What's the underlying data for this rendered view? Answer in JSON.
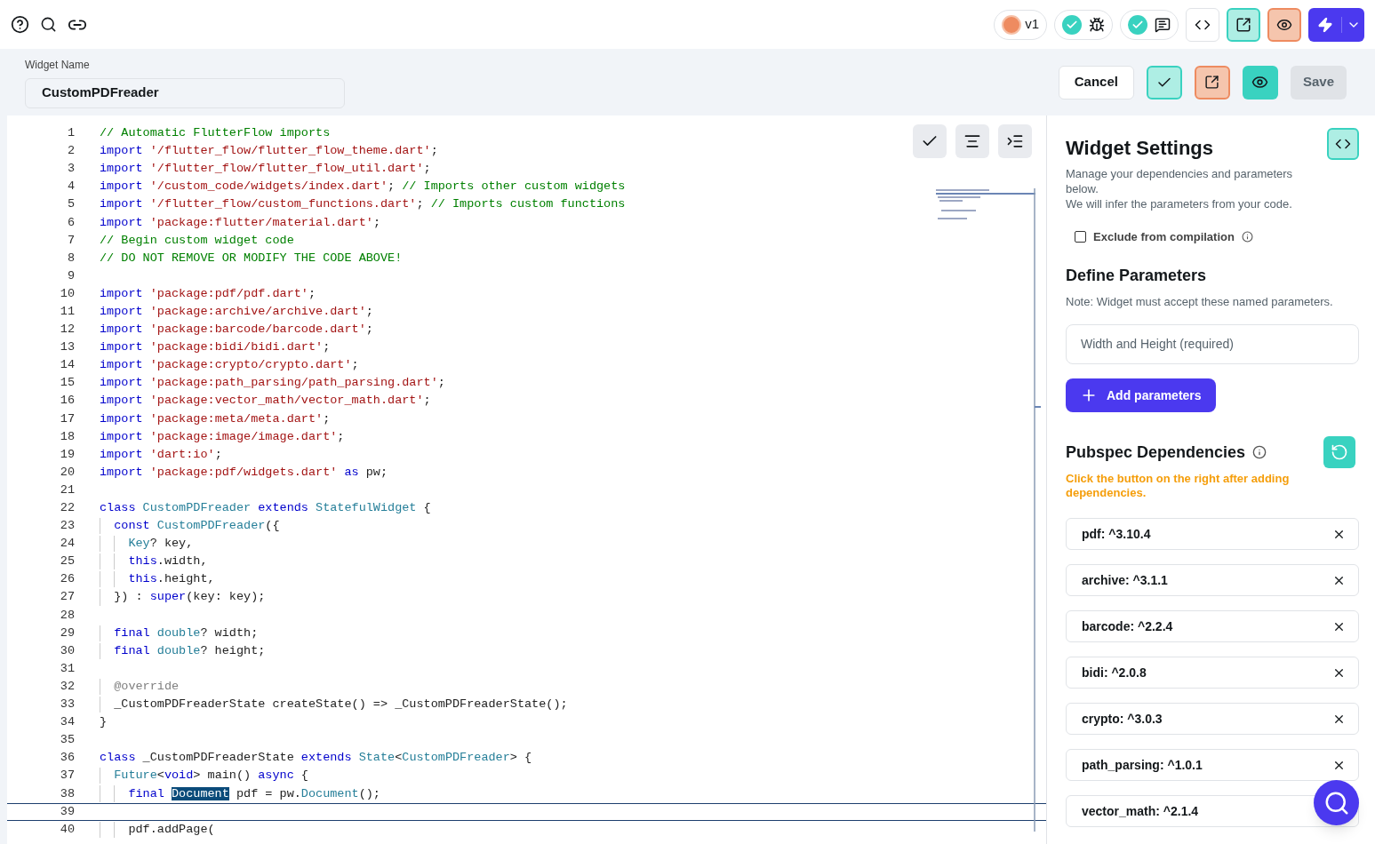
{
  "topbar": {
    "version": "v1"
  },
  "header": {
    "label": "Widget Name",
    "value": "CustomPDFreader",
    "cancel": "Cancel",
    "save": "Save"
  },
  "code": [
    {
      "n": "1",
      "current": false,
      "tokens": [
        {
          "kind": "comment",
          "text": "// Automatic FlutterFlow imports"
        }
      ]
    },
    {
      "n": "2",
      "current": false,
      "tokens": [
        {
          "kind": "keyword",
          "text": "import "
        },
        {
          "kind": "string",
          "text": "'/flutter_flow/flutter_flow_theme.dart'"
        },
        {
          "kind": "plain",
          "text": ";"
        }
      ]
    },
    {
      "n": "3",
      "current": false,
      "tokens": [
        {
          "kind": "keyword",
          "text": "import "
        },
        {
          "kind": "string",
          "text": "'/flutter_flow/flutter_flow_util.dart'"
        },
        {
          "kind": "plain",
          "text": ";"
        }
      ]
    },
    {
      "n": "4",
      "current": false,
      "tokens": [
        {
          "kind": "keyword",
          "text": "import "
        },
        {
          "kind": "string",
          "text": "'/custom_code/widgets/index.dart'"
        },
        {
          "kind": "plain",
          "text": "; "
        },
        {
          "kind": "comment",
          "text": "// Imports other custom widgets"
        }
      ]
    },
    {
      "n": "5",
      "current": false,
      "tokens": [
        {
          "kind": "keyword",
          "text": "import "
        },
        {
          "kind": "string",
          "text": "'/flutter_flow/custom_functions.dart'"
        },
        {
          "kind": "plain",
          "text": "; "
        },
        {
          "kind": "comment",
          "text": "// Imports custom functions"
        }
      ]
    },
    {
      "n": "6",
      "current": false,
      "tokens": [
        {
          "kind": "keyword",
          "text": "import "
        },
        {
          "kind": "string",
          "text": "'package:flutter/material.dart'"
        },
        {
          "kind": "plain",
          "text": ";"
        }
      ]
    },
    {
      "n": "7",
      "current": false,
      "tokens": [
        {
          "kind": "comment",
          "text": "// Begin custom widget code"
        }
      ]
    },
    {
      "n": "8",
      "current": false,
      "tokens": [
        {
          "kind": "comment",
          "text": "// DO NOT REMOVE OR MODIFY THE CODE ABOVE!"
        }
      ]
    },
    {
      "n": "9",
      "current": false
    },
    {
      "n": "10",
      "current": false,
      "tokens": [
        {
          "kind": "keyword",
          "text": "import "
        },
        {
          "kind": "string",
          "text": "'package:pdf/pdf.dart'"
        },
        {
          "kind": "plain",
          "text": ";"
        }
      ]
    },
    {
      "n": "11",
      "current": false,
      "tokens": [
        {
          "kind": "keyword",
          "text": "import "
        },
        {
          "kind": "string",
          "text": "'package:archive/archive.dart'"
        },
        {
          "kind": "plain",
          "text": ";"
        }
      ]
    },
    {
      "n": "12",
      "current": false,
      "tokens": [
        {
          "kind": "keyword",
          "text": "import "
        },
        {
          "kind": "string",
          "text": "'package:barcode/barcode.dart'"
        },
        {
          "kind": "plain",
          "text": ";"
        }
      ]
    },
    {
      "n": "13",
      "current": false,
      "tokens": [
        {
          "kind": "keyword",
          "text": "import "
        },
        {
          "kind": "string",
          "text": "'package:bidi/bidi.dart'"
        },
        {
          "kind": "plain",
          "text": ";"
        }
      ]
    },
    {
      "n": "14",
      "current": false,
      "tokens": [
        {
          "kind": "keyword",
          "text": "import "
        },
        {
          "kind": "string",
          "text": "'package:crypto/crypto.dart'"
        },
        {
          "kind": "plain",
          "text": ";"
        }
      ]
    },
    {
      "n": "15",
      "current": false,
      "tokens": [
        {
          "kind": "keyword",
          "text": "import "
        },
        {
          "kind": "string",
          "text": "'package:path_parsing/path_parsing.dart'"
        },
        {
          "kind": "plain",
          "text": ";"
        }
      ]
    },
    {
      "n": "16",
      "current": false,
      "tokens": [
        {
          "kind": "keyword",
          "text": "import "
        },
        {
          "kind": "string",
          "text": "'package:vector_math/vector_math.dart'"
        },
        {
          "kind": "plain",
          "text": ";"
        }
      ]
    },
    {
      "n": "17",
      "current": false,
      "tokens": [
        {
          "kind": "keyword",
          "text": "import "
        },
        {
          "kind": "string",
          "text": "'package:meta/meta.dart'"
        },
        {
          "kind": "plain",
          "text": ";"
        }
      ]
    },
    {
      "n": "18",
      "current": false,
      "tokens": [
        {
          "kind": "keyword",
          "text": "import "
        },
        {
          "kind": "string",
          "text": "'package:image/image.dart'"
        },
        {
          "kind": "plain",
          "text": ";"
        }
      ]
    },
    {
      "n": "19",
      "current": false,
      "tokens": [
        {
          "kind": "keyword",
          "text": "import "
        },
        {
          "kind": "string",
          "text": "'dart:io'"
        },
        {
          "kind": "plain",
          "text": ";"
        }
      ]
    },
    {
      "n": "20",
      "current": false,
      "tokens": [
        {
          "kind": "keyword",
          "text": "import "
        },
        {
          "kind": "string",
          "text": "'package:pdf/widgets.dart'"
        },
        {
          "kind": "keyword",
          "text": " as "
        },
        {
          "kind": "plain",
          "text": "pw;"
        }
      ]
    },
    {
      "n": "21",
      "current": false
    },
    {
      "n": "22",
      "current": false,
      "tokens": [
        {
          "kind": "keyword",
          "text": "class "
        },
        {
          "kind": "type",
          "text": "CustomPDFreader "
        },
        {
          "kind": "keyword",
          "text": "extends "
        },
        {
          "kind": "type",
          "text": "StatefulWidget "
        },
        {
          "kind": "plain",
          "text": "{"
        }
      ]
    },
    {
      "n": "23",
      "current": false,
      "tokens": [
        {
          "kind": "keyword",
          "text": "  const "
        },
        {
          "kind": "type",
          "text": "CustomPDFreader"
        },
        {
          "kind": "plain",
          "text": "({"
        }
      ]
    },
    {
      "n": "24",
      "current": false,
      "tokens": [
        {
          "kind": "type",
          "text": "    Key"
        },
        {
          "kind": "plain",
          "text": "? key,"
        }
      ]
    },
    {
      "n": "25",
      "current": false,
      "tokens": [
        {
          "kind": "keyword",
          "text": "    this"
        },
        {
          "kind": "plain",
          "text": ".width,"
        }
      ]
    },
    {
      "n": "26",
      "current": false,
      "tokens": [
        {
          "kind": "keyword",
          "text": "    this"
        },
        {
          "kind": "plain",
          "text": ".height,"
        }
      ]
    },
    {
      "n": "27",
      "current": false,
      "tokens": [
        {
          "kind": "plain",
          "text": "  }) : "
        },
        {
          "kind": "keyword",
          "text": "super"
        },
        {
          "kind": "plain",
          "text": "(key: key);"
        }
      ]
    },
    {
      "n": "28",
      "current": false
    },
    {
      "n": "29",
      "current": false,
      "tokens": [
        {
          "kind": "keyword",
          "text": "  final "
        },
        {
          "kind": "type",
          "text": "double"
        },
        {
          "kind": "plain",
          "text": "? width;"
        }
      ]
    },
    {
      "n": "30",
      "current": false,
      "tokens": [
        {
          "kind": "keyword",
          "text": "  final "
        },
        {
          "kind": "type",
          "text": "double"
        },
        {
          "kind": "plain",
          "text": "? height;"
        }
      ]
    },
    {
      "n": "31",
      "current": false
    },
    {
      "n": "32",
      "current": false,
      "tokens": [
        {
          "kind": "annotation",
          "text": "  @override"
        }
      ]
    },
    {
      "n": "33",
      "current": false,
      "tokens": [
        {
          "kind": "plain",
          "text": "  _CustomPDFreaderState createState() => _CustomPDFreaderState();"
        }
      ]
    },
    {
      "n": "34",
      "current": false,
      "tokens": [
        {
          "kind": "plain",
          "text": "}"
        }
      ]
    },
    {
      "n": "35",
      "current": false
    },
    {
      "n": "36",
      "current": false,
      "tokens": [
        {
          "kind": "keyword",
          "text": "class "
        },
        {
          "kind": "plain",
          "text": "_CustomPDFreaderState "
        },
        {
          "kind": "keyword",
          "text": "extends "
        },
        {
          "kind": "type",
          "text": "State"
        },
        {
          "kind": "plain",
          "text": "<"
        },
        {
          "kind": "type",
          "text": "CustomPDFreader"
        },
        {
          "kind": "plain",
          "text": "> {"
        }
      ]
    },
    {
      "n": "37",
      "current": false,
      "tokens": [
        {
          "kind": "type",
          "text": "  Future"
        },
        {
          "kind": "plain",
          "text": "<"
        },
        {
          "kind": "keyword",
          "text": "void"
        },
        {
          "kind": "plain",
          "text": "> main() "
        },
        {
          "kind": "keyword",
          "text": "async "
        },
        {
          "kind": "plain",
          "text": "{"
        }
      ]
    },
    {
      "n": "38",
      "current": false,
      "tokens": [
        {
          "kind": "keyword",
          "text": "    final "
        },
        {
          "kind": "selected",
          "text": "Document"
        },
        {
          "kind": "plain",
          "text": " pdf = pw."
        },
        {
          "kind": "type",
          "text": "Document"
        },
        {
          "kind": "plain",
          "text": "();"
        }
      ]
    },
    {
      "n": "39",
      "current": true
    },
    {
      "n": "40",
      "current": false,
      "tokens": [
        {
          "kind": "plain",
          "text": "    pdf.addPage("
        }
      ]
    }
  ],
  "settings": {
    "title": "Widget Settings",
    "description": "Manage your dependencies and parameters below.",
    "description_2": "We will infer the parameters from your code.",
    "exclude": {
      "label": "Exclude from compilation",
      "checked": false
    }
  },
  "parameters": {
    "title": "Define Parameters",
    "note": "Note: Widget must accept these named parameters.",
    "items": [
      "Width and Height (required)"
    ],
    "add": "Add parameters"
  },
  "dependencies": {
    "title": "Pubspec Dependencies",
    "warning": "Click the button on the right after adding dependencies.",
    "items": [
      "pdf: ^3.10.4",
      "archive: ^3.1.1",
      "barcode: ^2.2.4",
      "bidi: ^2.0.8",
      "crypto: ^3.0.3",
      "path_parsing: ^1.0.1",
      "vector_math: ^2.1.4"
    ]
  }
}
